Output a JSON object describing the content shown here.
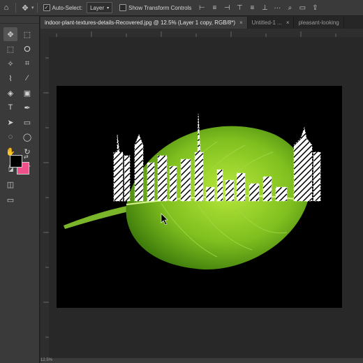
{
  "options_bar": {
    "home_icon": "home-icon",
    "move_icon": "move-tool-icon",
    "auto_select_label": "Auto-Select:",
    "auto_select_checked": true,
    "layer_select_value": "Layer",
    "show_transform_label": "Show Transform Controls",
    "show_transform_checked": false
  },
  "tabs": [
    {
      "label": "indoor-plant-textures-details-Recovered.jpg @ 12.5% (Layer 1 copy, RGB/8*)",
      "active": true,
      "close": "×"
    },
    {
      "label": "Untitled-1 ...",
      "active": false,
      "close": "×"
    },
    {
      "label": "pleasant-looking",
      "active": false,
      "close": ""
    }
  ],
  "colors": {
    "foreground": "#000000",
    "background": "#f0508a",
    "leaf": "#7fbf1f",
    "canvas_bg": "#000000"
  },
  "rulers": {
    "top": [
      "0",
      "5",
      "0",
      "5",
      "0",
      "5",
      "0",
      "5",
      "0",
      "5",
      "0",
      "5",
      "0",
      "5",
      "0",
      "5",
      "0"
    ],
    "left": [
      "0",
      "5",
      "0",
      "5",
      "0",
      "5",
      "0",
      "5",
      "0",
      "5",
      "0",
      "5",
      "0",
      "5",
      "0",
      "5",
      "0"
    ]
  },
  "status": {
    "zoom": "12.5%",
    "doc_info": ""
  }
}
